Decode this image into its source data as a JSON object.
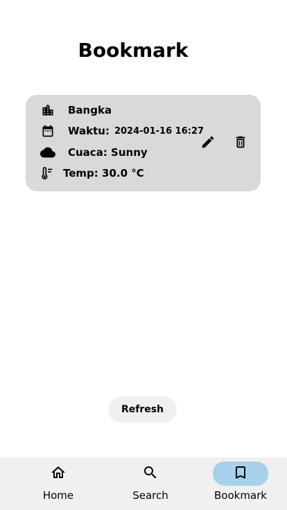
{
  "page": {
    "title": "Bookmark"
  },
  "bookmark": {
    "city": "Bangka",
    "time_label": "Waktu:",
    "time_value": "2024-01-16 16:27",
    "weather": "Cuaca: Sunny",
    "temp": "Temp: 30.0 °C"
  },
  "actions": {
    "refresh_label": "Refresh"
  },
  "nav": {
    "items": [
      {
        "label": "Home",
        "icon": "home-icon"
      },
      {
        "label": "Search",
        "icon": "search-icon"
      },
      {
        "label": "Bookmark",
        "icon": "bookmark-icon",
        "active": true
      }
    ]
  },
  "colors": {
    "card_bg": "#d9d9d9",
    "nav_bg": "#f0f0f0",
    "nav_active": "#a6d0ec",
    "button_bg": "#f0f0f0"
  }
}
